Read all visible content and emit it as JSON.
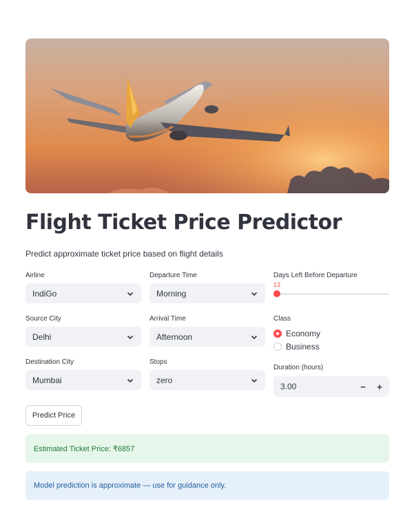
{
  "header": {
    "title": "Flight Ticket Price Predictor",
    "subtitle": "Predict approximate ticket price based on flight details"
  },
  "form": {
    "airline": {
      "label": "Airline",
      "value": "IndiGo"
    },
    "departure_time": {
      "label": "Departure Time",
      "value": "Morning"
    },
    "days_left": {
      "label": "Days Left Before Departure",
      "value": "13",
      "fraction": 0.03
    },
    "source_city": {
      "label": "Source City",
      "value": "Delhi"
    },
    "arrival_time": {
      "label": "Arrival Time",
      "value": "Afternoon"
    },
    "travel_class": {
      "label": "Class",
      "options": [
        "Economy",
        "Business"
      ],
      "selected": "Economy"
    },
    "destination_city": {
      "label": "Destination City",
      "value": "Mumbai"
    },
    "stops": {
      "label": "Stops",
      "value": "zero"
    },
    "duration": {
      "label": "Duration (hours)",
      "value": "3.00",
      "minus": "−",
      "plus": "+"
    }
  },
  "actions": {
    "predict_label": "Predict Price"
  },
  "result": {
    "success_text": "Estimated Ticket Price: ₹6857",
    "info_text": "Model prediction is approximate — use for guidance only."
  },
  "colors": {
    "accent": "#ff4b4b",
    "success_bg": "#e6f6ea",
    "success_text": "#1f7a3c",
    "info_bg": "#e6f0fb",
    "info_text": "#1d5b9a"
  }
}
